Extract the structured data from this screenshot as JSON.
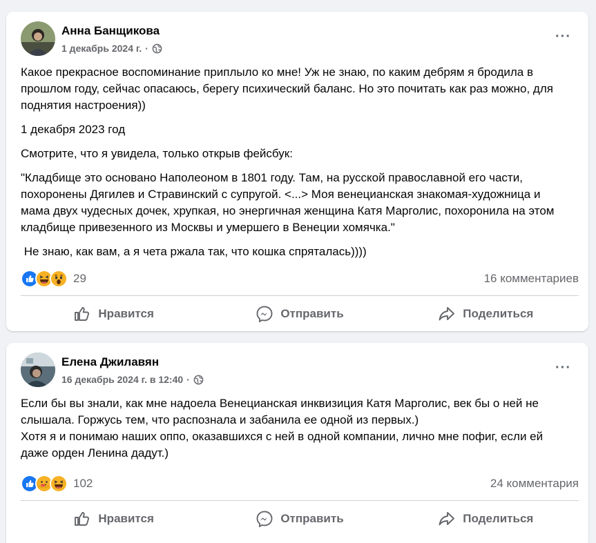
{
  "posts": [
    {
      "author": "Анна Банщикова",
      "date": "1 декабрь 2024 г.",
      "separator": "·",
      "globe_icon": "globe-icon",
      "more": "···",
      "paragraphs": [
        "Какое прекрасное воспоминание приплыло ко мне! Уж не знаю, по каким дебрям я бродила в прошлом году, сейчас опасаюсь, берегу психический баланс. Но это почитать как раз можно, для поднятия настроения))",
        "1 декабря 2023 год",
        "Смотрите, что я увидела, только открыв фейсбук:",
        "\"Кладбище это основано Наполеоном в 1801 году. Там, на русской православной его части, похоронены Дягилев и Стравинский с супругой. <...> Моя венецианская знакомая-художница и мама двух чудесных дочек, хрупкая, но энергичная женщина Катя Марголис, похоронила на этом кладбище привезенного из Москвы и умершего в Венеции хомячка.\"",
        " Не знаю, как вам, а я чета ржала так, что кошка спряталась))))"
      ],
      "reactions": [
        "like",
        "haha",
        "wow"
      ],
      "reaction_count": "29",
      "comments": "16 комментариев"
    },
    {
      "author": "Елена Джилавян",
      "date": "16 декабрь 2024 г. в 12:40",
      "separator": "·",
      "globe_icon": "globe-icon",
      "more": "···",
      "paragraphs": [
        "Если бы вы знали, как мне надоела Венецианская инквизиция Катя Марголис, век бы о ней не слышала. Горжусь тем, что распознала и забанила ее одной из первых.)",
        "Хотя я и понимаю наших оппо, оказавшихся с ней в одной компании, лично мне пофиг, если ей даже орден Ленина дадут.)"
      ],
      "reactions": [
        "like",
        "care",
        "haha"
      ],
      "reaction_count": "102",
      "comments": "24 комментария"
    }
  ],
  "actions": {
    "like": "Нравится",
    "send": "Отправить",
    "share": "Поделиться"
  },
  "colors": {
    "background": "#f0f2f5",
    "muted_text": "#65676b",
    "like_blue": "#1877f2",
    "emoji_yellow": "#f7b125"
  }
}
